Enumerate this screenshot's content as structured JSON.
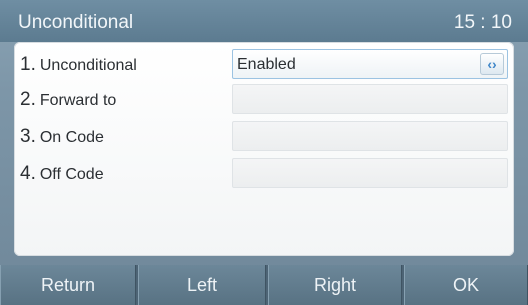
{
  "header": {
    "title": "Unconditional",
    "time": "15 : 10"
  },
  "rows": [
    {
      "number": "1.",
      "label": "Unconditional",
      "value": "Enabled",
      "switch_glyph": "‹›",
      "switch_icon": "left-right-arrows-icon"
    },
    {
      "number": "2.",
      "label": "Forward to",
      "value": ""
    },
    {
      "number": "3.",
      "label": "On Code",
      "value": ""
    },
    {
      "number": "4.",
      "label": "Off Code",
      "value": ""
    }
  ],
  "softkeys": [
    "Return",
    "Left",
    "Right",
    "OK"
  ]
}
